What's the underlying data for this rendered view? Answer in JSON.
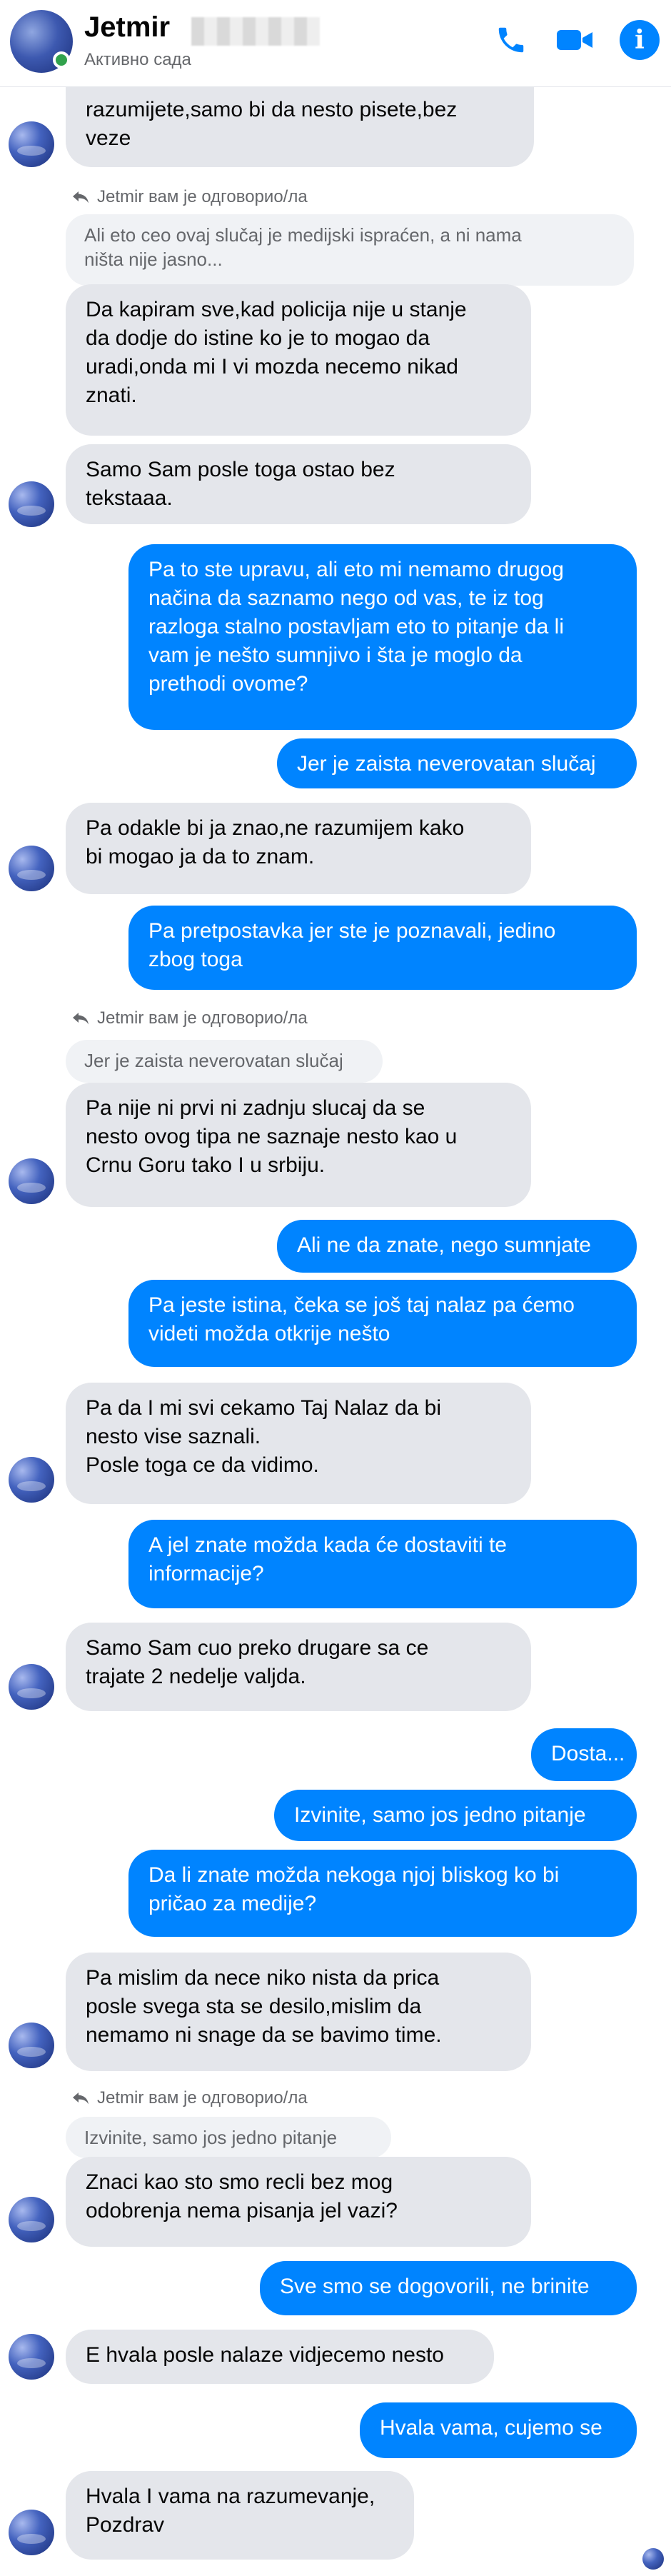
{
  "header": {
    "name": "Jetmir",
    "status": "Активно сада",
    "colors": {
      "accent": "#0084ff",
      "online": "#31a24c"
    },
    "icons": [
      "phone-icon",
      "video-icon",
      "info-icon"
    ]
  },
  "messages": [
    {
      "side": "in",
      "text": "razumijete,samo bi da nesto pisete,bez\nveze"
    },
    {
      "reply_label": "Jetmir вам је одговорио/ла",
      "quoted": "Ali eto ceo ovaj slučaj je medijski ispraćen, a ni nama\nništa nije jasno..."
    },
    {
      "side": "in",
      "text": "Da kapiram sve,kad policija nije u stanje\nda dodje do istine ko je to mogao da\nuradi,onda mi I vi mozda necemo nikad\nznati."
    },
    {
      "side": "in",
      "text": "Samo Sam posle toga ostao bez\ntekstaaa."
    },
    {
      "side": "out",
      "text": "Pa to ste upravu, ali eto mi nemamo drugog\nnačina da saznamo nego od vas, te iz tog\nrazloga stalno postavljam eto to pitanje da li\nvam je nešto sumnjivo i šta je moglo da\nprethodi ovome?"
    },
    {
      "side": "out",
      "text": "Jer je zaista neverovatan slučaj"
    },
    {
      "side": "in",
      "text": "Pa odakle bi ja znao,ne razumijem kako\nbi mogao ja da to znam."
    },
    {
      "side": "out",
      "text": "Pa pretpostavka jer ste je poznavali, jedino\nzbog toga"
    },
    {
      "reply_label": "Jetmir вам је одговорио/ла",
      "quoted": "Jer je zaista neverovatan slučaj"
    },
    {
      "side": "in",
      "text": "Pa nije ni prvi ni zadnju slucaj da se\nnesto ovog tipa ne saznaje nesto kao u\nCrnu Goru tako I u srbiju."
    },
    {
      "side": "out",
      "text": "Ali ne da znate, nego sumnjate"
    },
    {
      "side": "out",
      "text": "Pa jeste istina, čeka se još taj nalaz pa ćemo\nvideti možda otkrije nešto"
    },
    {
      "side": "in",
      "text": "Pa da I mi svi cekamo Taj Nalaz da bi\nnesto vise saznali.\nPosle toga ce da vidimo."
    },
    {
      "side": "out",
      "text": "A jel znate možda kada će dostaviti te\ninformacije?"
    },
    {
      "side": "in",
      "text": "Samo Sam cuo preko drugare sa ce\ntrajate 2 nedelje valjda."
    },
    {
      "side": "out",
      "text": "Dosta..."
    },
    {
      "side": "out",
      "text": "Izvinite, samo jos jedno pitanje"
    },
    {
      "side": "out",
      "text": "Da li znate možda nekoga njoj bliskog ko bi\npričao za medije?"
    },
    {
      "side": "in",
      "text": "Pa mislim da nece niko nista da prica\nposle svega sta se desilo,mislim da\nnemamo ni snage da se bavimo time."
    },
    {
      "reply_label": "Jetmir вам је одговорио/ла",
      "quoted": "Izvinite, samo jos jedno pitanje"
    },
    {
      "side": "in",
      "text": "Znaci kao sto smo recli bez mog\nodobrenja nema pisanja jel vazi?"
    },
    {
      "side": "out",
      "text": "Sve smo se dogovorili, ne brinite"
    },
    {
      "side": "in",
      "text": "E hvala posle nalaze vidjecemo nesto"
    },
    {
      "side": "out",
      "text": "Hvala vama, cujemo se"
    },
    {
      "side": "in",
      "text": "Hvala I vama na razumevanje,\nPozdrav"
    }
  ]
}
